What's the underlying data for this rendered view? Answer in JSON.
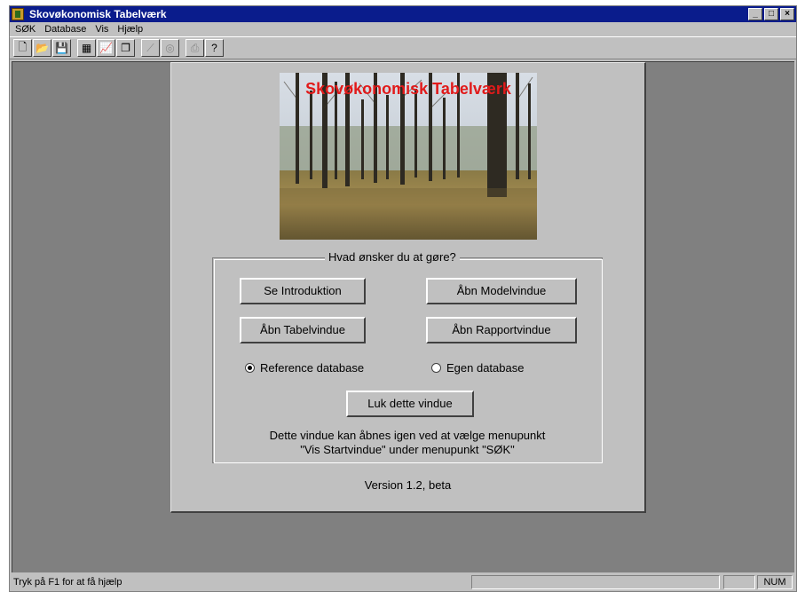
{
  "window": {
    "title": "Skovøkonomisk Tabelværk",
    "controls": [
      "_",
      "□",
      "×"
    ]
  },
  "menu": [
    "SØK",
    "Database",
    "Vis",
    "Hjælp"
  ],
  "toolbar": [
    {
      "icon": "new-document-icon",
      "glyph": "🗋",
      "enabled": true
    },
    {
      "icon": "open-folder-icon",
      "glyph": "📂",
      "enabled": true
    },
    {
      "icon": "save-icon",
      "glyph": "💾",
      "enabled": false
    },
    {
      "icon": "table-icon",
      "glyph": "▦",
      "enabled": true
    },
    {
      "icon": "chart-icon",
      "glyph": "📈",
      "enabled": true
    },
    {
      "icon": "copy-windows-icon",
      "glyph": "❐",
      "enabled": true
    },
    {
      "icon": "curve-icon",
      "glyph": "⟋",
      "enabled": false
    },
    {
      "icon": "circle-icon",
      "glyph": "◎",
      "enabled": false
    },
    {
      "icon": "print-icon",
      "glyph": "⎙",
      "enabled": false
    },
    {
      "icon": "help-pointer-icon",
      "glyph": "?",
      "enabled": true
    }
  ],
  "dialog": {
    "photo_title": "Skovøkonomisk Tabelværk",
    "group_label": "Hvad ønsker du at gøre?",
    "buttons": {
      "intro": "Se Introduktion",
      "model": "Åbn Modelvindue",
      "table": "Åbn Tabelvindue",
      "report": "Åbn Rapportvindue",
      "close": "Luk dette vindue"
    },
    "radios": {
      "reference": "Reference database",
      "own": "Egen database",
      "selected": "reference"
    },
    "info_line1": "Dette vindue kan åbnes igen ved at vælge menupunkt",
    "info_line2": "\"Vis Startvindue\" under menupunkt \"SØK\"",
    "version": "Version 1.2, beta"
  },
  "status": {
    "hint": "Tryk på F1 for at få hjælp",
    "num": "NUM"
  },
  "colors": {
    "title_bar": "#0a1c8c",
    "face": "#c0c0c0",
    "mdi_background": "#808080",
    "photo_title": "#e11a1a"
  }
}
